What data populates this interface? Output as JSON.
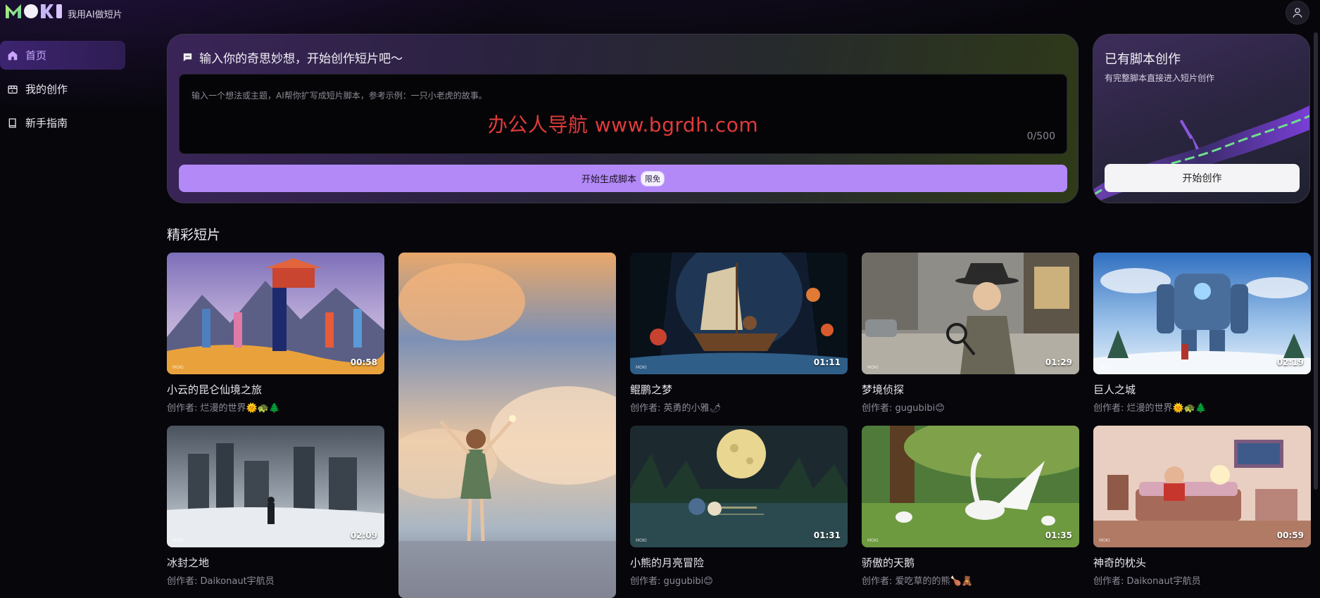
{
  "app": {
    "tagline": "我用AI做短片"
  },
  "sidebar": {
    "items": [
      {
        "label": "首页",
        "icon": "home-icon",
        "active": true
      },
      {
        "label": "我的创作",
        "icon": "film-icon",
        "active": false
      },
      {
        "label": "新手指南",
        "icon": "book-icon",
        "active": false
      }
    ]
  },
  "prompt": {
    "title": "输入你的奇思妙想，开始创作短片吧～",
    "placeholder": "输入一个想法或主题，AI帮你扩写成短片脚本，参考示例：一只小老虎的故事。",
    "watermark": "办公人导航 www.bgrdh.com",
    "char_count": "0/500",
    "generate_label": "开始生成脚本",
    "free_badge": "限免"
  },
  "script_card": {
    "title": "已有脚本创作",
    "subtitle": "有完整脚本直接进入短片创作",
    "button_label": "开始创作"
  },
  "featured": {
    "section_title": "精彩短片",
    "videos": [
      {
        "title": "小云的昆仑仙境之旅",
        "creator": "创作者: 烂漫的世界🌞🐢🌲",
        "duration": "00:58"
      },
      {
        "title": "鲲鹏之梦",
        "creator": "创作者: 英勇的小雅🌶",
        "duration": "01:11"
      },
      {
        "title": "梦境侦探",
        "creator": "创作者: gugubibi😊",
        "duration": "01:29"
      },
      {
        "title": "巨人之城",
        "creator": "创作者: 烂漫的世界🌞🐢🌲",
        "duration": "02:19"
      },
      {
        "title": "冰封之地",
        "creator": "创作者: Daikonaut宇航员",
        "duration": "02:09"
      },
      {
        "title": "小熊的月亮冒险",
        "creator": "创作者: gugubibi😊",
        "duration": "01:31"
      },
      {
        "title": "骄傲的天鹅",
        "creator": "创作者: 爱吃草的的熊🍗🧸",
        "duration": "01:35"
      },
      {
        "title": "神奇的枕头",
        "creator": "创作者: Daikonaut宇航员",
        "duration": "00:59"
      }
    ]
  }
}
